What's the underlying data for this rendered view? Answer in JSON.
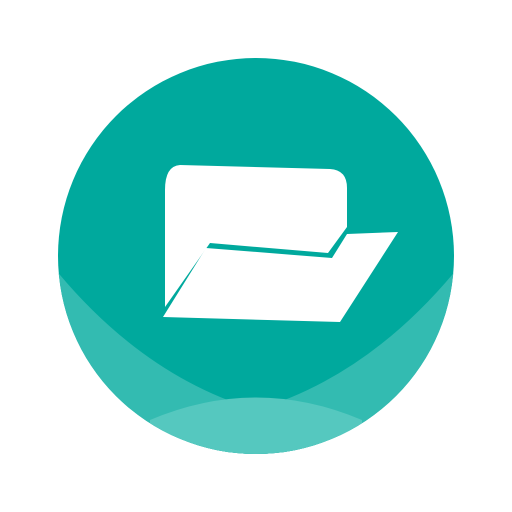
{
  "icon": {
    "name": "folder-icon",
    "colors": {
      "background": "#ffffff",
      "circle": "#00a99d",
      "wave_light": "#33bbb1",
      "wave_lighter": "#55c8bf",
      "folder": "#ffffff"
    }
  }
}
